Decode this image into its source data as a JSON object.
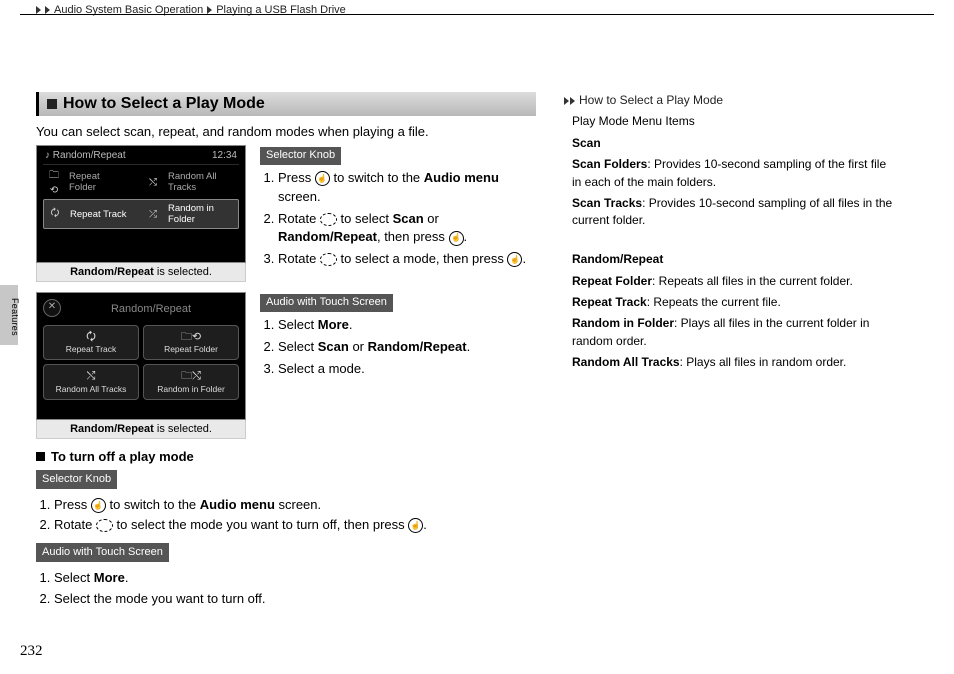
{
  "breadcrumb": {
    "a": "Audio System Basic Operation",
    "b": "Playing a USB Flash Drive"
  },
  "pageNumber": "232",
  "sideTab": "Features",
  "section": {
    "title": "How to Select a Play Mode",
    "intro": "You can select scan, repeat, and random modes when playing a file."
  },
  "screen1": {
    "title": "Random/Repeat",
    "clock": "12:34",
    "row1a": "Repeat\nFolder",
    "row1b": "Random All\nTracks",
    "row2a": "Repeat Track",
    "row2b": "Random in\nFolder",
    "caption_pre": "Random/Repeat",
    "caption_post": " is selected."
  },
  "knobTag": "Selector Knob",
  "knobSteps": {
    "s1a": "Press ",
    "s1b": " to switch to the ",
    "s1c": "Audio menu",
    "s1d": " screen.",
    "s2a": "Rotate ",
    "s2b": " to select ",
    "s2c": "Scan",
    "s2d": " or ",
    "s2e": "Random/Repeat",
    "s2f": ", then press ",
    "s2g": ".",
    "s3a": "Rotate ",
    "s3b": " to select a mode, then press ",
    "s3c": "."
  },
  "screen2": {
    "title": "Random/Repeat",
    "b1": "Repeat Track",
    "b2": "Repeat Folder",
    "b3": "Random All Tracks",
    "b4": "Random in Folder",
    "caption_pre": "Random/Repeat",
    "caption_post": " is selected."
  },
  "touchTag": "Audio with Touch Screen",
  "touchSteps": {
    "s1a": "Select ",
    "s1b": "More",
    "s1c": ".",
    "s2a": "Select ",
    "s2b": "Scan",
    "s2c": " or ",
    "s2d": "Random/Repeat",
    "s2e": ".",
    "s3": "Select a mode."
  },
  "turnOff": {
    "head": "To turn off a play mode",
    "k1a": "Press ",
    "k1b": " to switch to the ",
    "k1c": "Audio menu",
    "k1d": " screen.",
    "k2a": "Rotate ",
    "k2b": " to select the mode you want to turn off, then press ",
    "k2c": ".",
    "t1a": "Select ",
    "t1b": "More",
    "t1c": ".",
    "t2": "Select the mode you want to turn off."
  },
  "right": {
    "head": "How to Select a Play Mode",
    "pmTitle": "Play Mode Menu Items",
    "scan": "Scan",
    "sf_lbl": "Scan Folders",
    "sf_txt": ": Provides 10-second sampling of the first file in each of the main folders.",
    "st_lbl": "Scan Tracks",
    "st_txt": ": Provides 10-second sampling of all files in the current folder.",
    "rr": "Random/Repeat",
    "rf_lbl": "Repeat Folder",
    "rf_txt": ": Repeats all files in the current folder.",
    "rt_lbl": "Repeat Track",
    "rt_txt": ": Repeats the current file.",
    "rif_lbl": "Random in Folder",
    "rif_txt": ": Plays all files in the current folder in random order.",
    "rat_lbl": "Random All Tracks",
    "rat_txt": ": Plays all files in random order."
  }
}
